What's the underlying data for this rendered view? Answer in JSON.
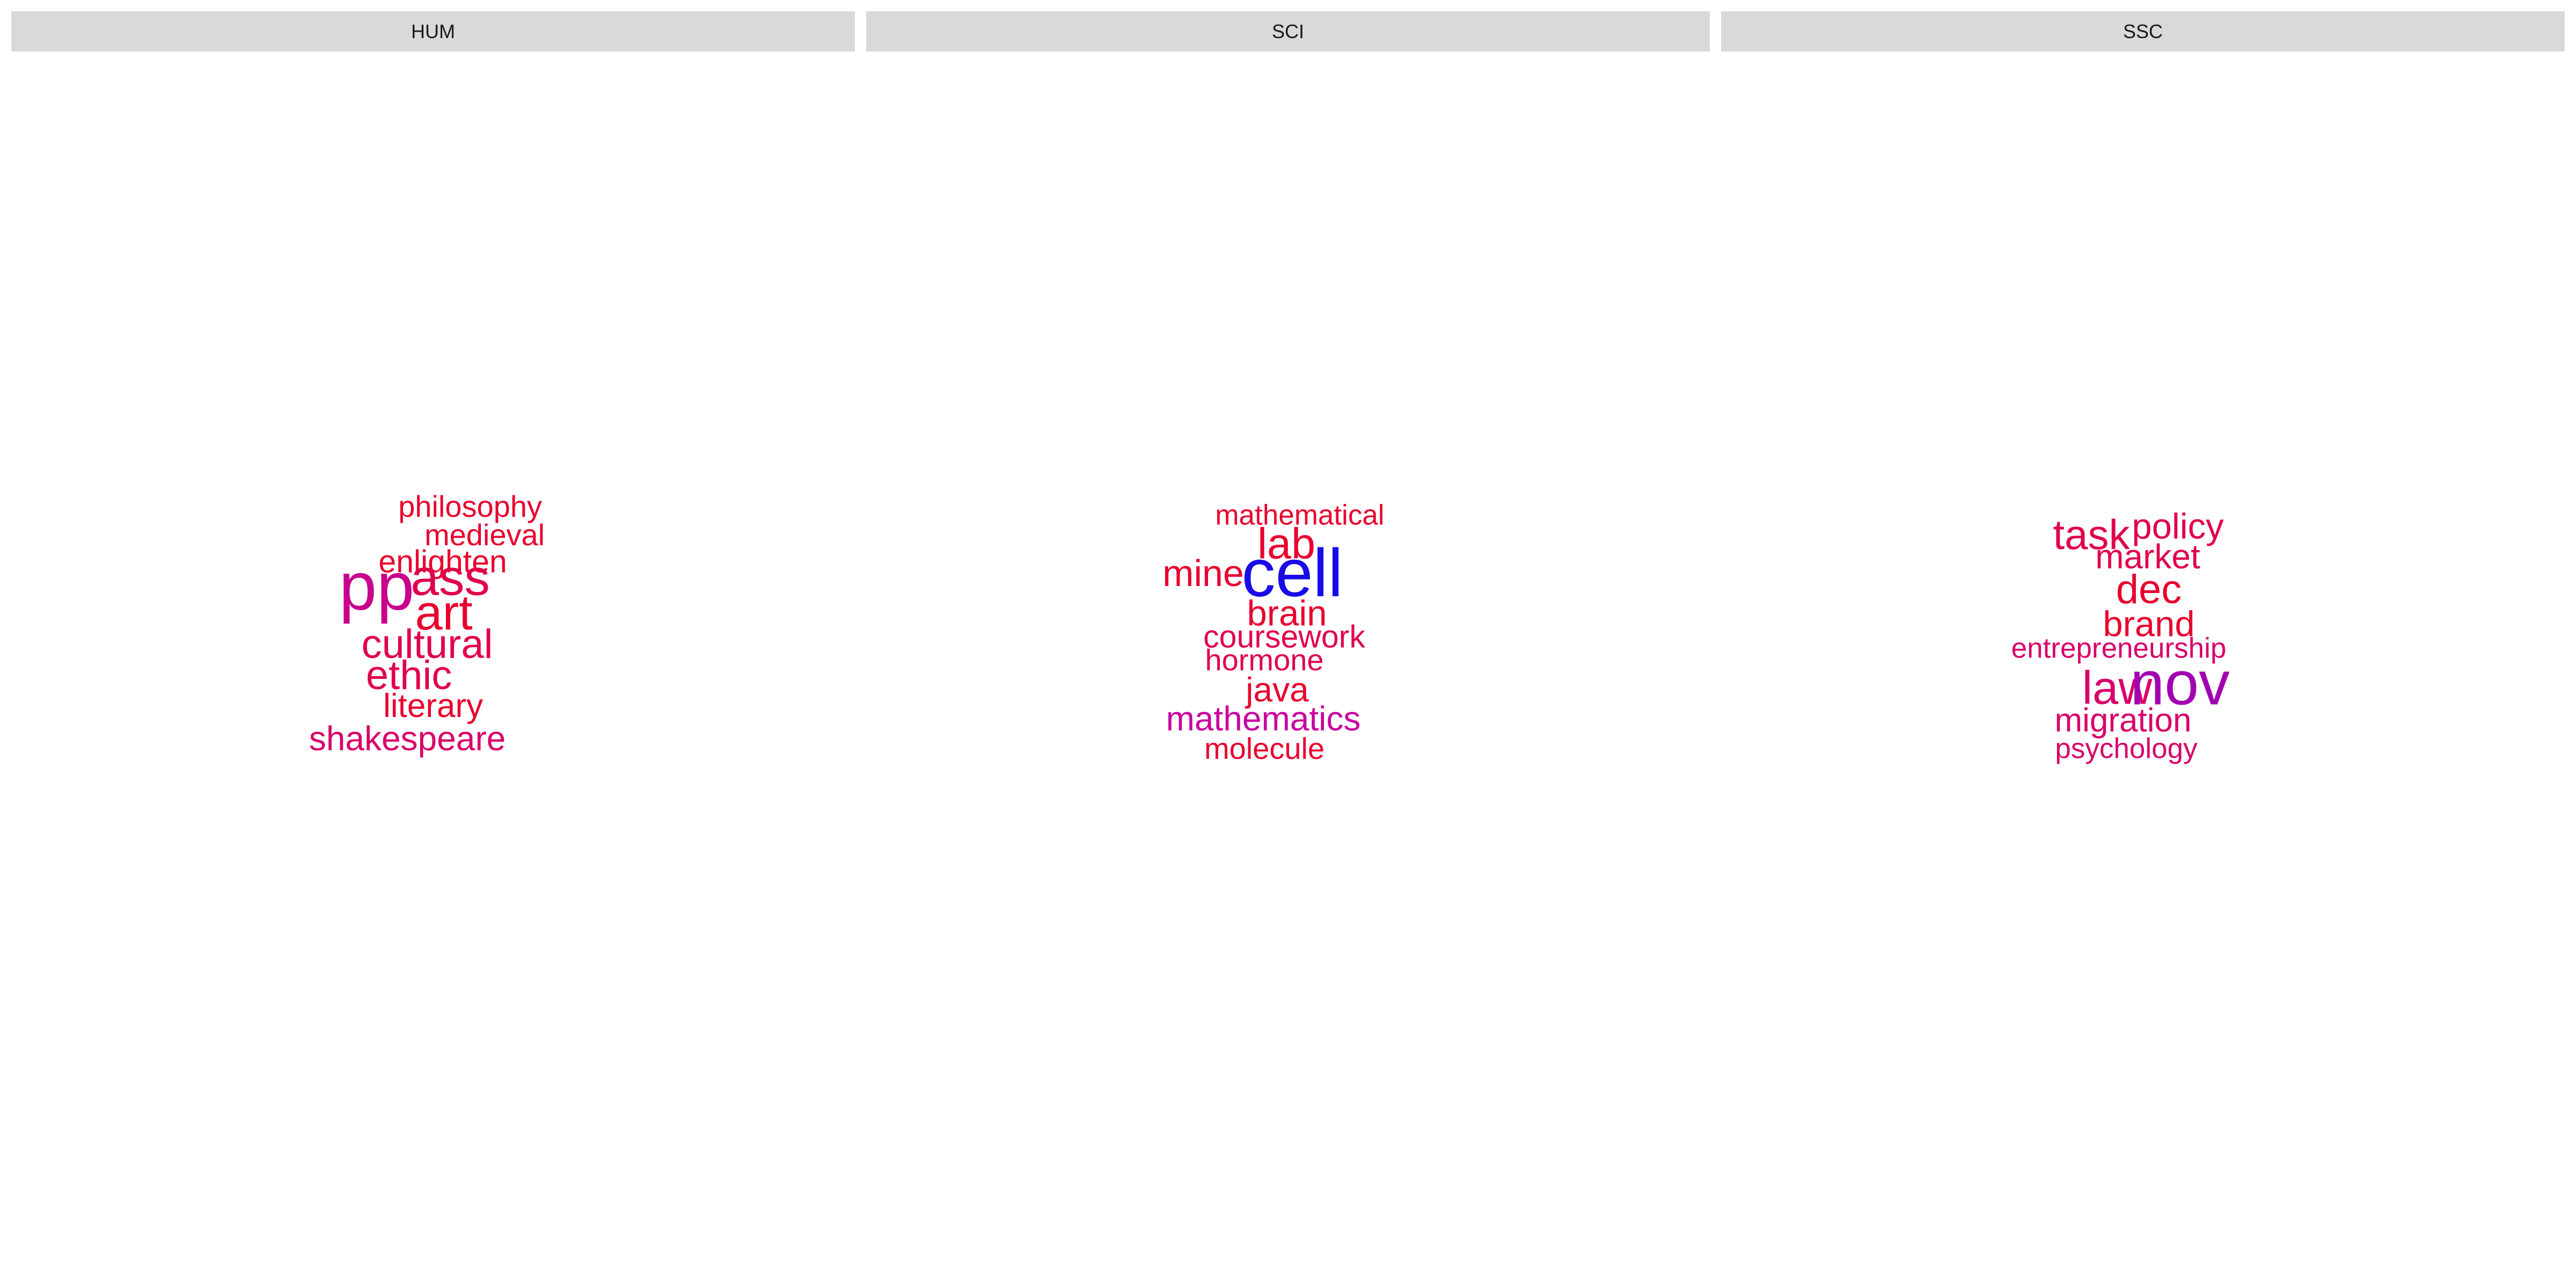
{
  "chart_data": [
    {
      "type": "wordcloud",
      "facet": "HUM",
      "words": [
        {
          "text": "philosophy",
          "size": 2.0,
          "color": "#e8002e"
        },
        {
          "text": "medieval",
          "size": 2.0,
          "color": "#e8002e"
        },
        {
          "text": "enlighten",
          "size": 2.1,
          "color": "#e8002e"
        },
        {
          "text": "pp",
          "size": 4.5,
          "color": "#c8008c"
        },
        {
          "text": "ass",
          "size": 3.4,
          "color": "#e0004a"
        },
        {
          "text": "art",
          "size": 3.3,
          "color": "#e8002e"
        },
        {
          "text": "cultural",
          "size": 2.7,
          "color": "#e0004a"
        },
        {
          "text": "ethic",
          "size": 2.7,
          "color": "#e0004a"
        },
        {
          "text": "literary",
          "size": 2.2,
          "color": "#e8002e"
        },
        {
          "text": "shakespeare",
          "size": 2.3,
          "color": "#d8006a"
        }
      ]
    },
    {
      "type": "wordcloud",
      "facet": "SCI",
      "words": [
        {
          "text": "mathematical",
          "size": 1.9,
          "color": "#e8002e"
        },
        {
          "text": "lab",
          "size": 2.9,
          "color": "#e8002e"
        },
        {
          "text": "mine",
          "size": 2.5,
          "color": "#e8002e"
        },
        {
          "text": "cell",
          "size": 4.5,
          "color": "#1a0ae8"
        },
        {
          "text": "brain",
          "size": 2.4,
          "color": "#e8002e"
        },
        {
          "text": "coursework",
          "size": 2.1,
          "color": "#e0004a"
        },
        {
          "text": "hormone",
          "size": 2.0,
          "color": "#e0004a"
        },
        {
          "text": "java",
          "size": 2.3,
          "color": "#e8002e"
        },
        {
          "text": "mathematics",
          "size": 2.3,
          "color": "#c800a0"
        },
        {
          "text": "molecule",
          "size": 2.0,
          "color": "#e8002e"
        }
      ]
    },
    {
      "type": "wordcloud",
      "facet": "SSC",
      "words": [
        {
          "text": "task",
          "size": 2.8,
          "color": "#e0004a"
        },
        {
          "text": "policy",
          "size": 2.4,
          "color": "#e0004a"
        },
        {
          "text": "market",
          "size": 2.3,
          "color": "#e0004a"
        },
        {
          "text": "dec",
          "size": 2.7,
          "color": "#e8002e"
        },
        {
          "text": "brand",
          "size": 2.4,
          "color": "#e8002e"
        },
        {
          "text": "entrepreneurship",
          "size": 1.9,
          "color": "#d8006a"
        },
        {
          "text": "law",
          "size": 3.1,
          "color": "#d8006a"
        },
        {
          "text": "nov",
          "size": 4.1,
          "color": "#a000b0"
        },
        {
          "text": "migration",
          "size": 2.2,
          "color": "#d8006a"
        },
        {
          "text": "psychology",
          "size": 1.9,
          "color": "#d8006a"
        }
      ]
    }
  ]
}
